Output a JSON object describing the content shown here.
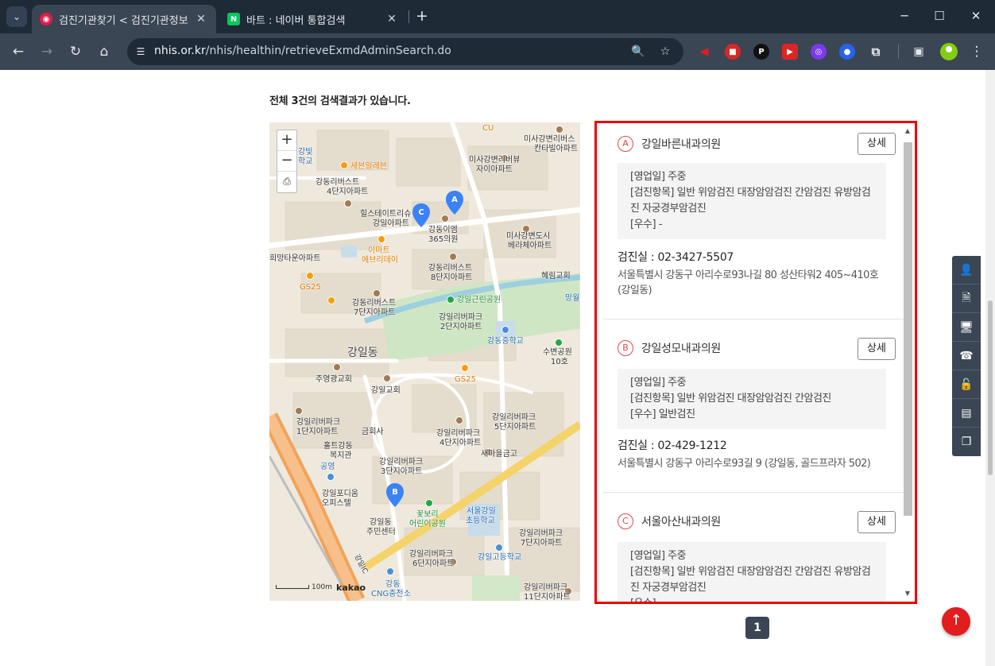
{
  "browser": {
    "tabs": [
      {
        "title": "검진기관찾기 < 검진기관정보",
        "active": true,
        "favicon": "nhis-favicon"
      },
      {
        "title": "바트 : 네이버 통합검색",
        "active": false,
        "favicon": "naver-favicon"
      }
    ],
    "favicon_naver_letter": "N",
    "new_tab_symbol": "+",
    "url_host": "nhis.or.kr",
    "url_path": "/nhis/healthin/retrieveExmdAdminSearch.do",
    "window_controls": {
      "minimize": "─",
      "maximize": "☐",
      "close": "✕"
    }
  },
  "page": {
    "result_count_text": "전체 3건의 검색결과가 있습니다.",
    "pagination": {
      "current": "1"
    }
  },
  "map": {
    "controls": {
      "zoom_in": "+",
      "zoom_out": "−"
    },
    "scale_label": "100m",
    "provider": "kakao",
    "district_label": "강일동",
    "markers": [
      "A",
      "B",
      "C"
    ],
    "labels": [
      "CU",
      "미사강변리버스",
      "칸타빌아파트",
      "강빛",
      "학교",
      "세븐일레븐",
      "미사강변리버뷰",
      "자이아파트",
      "강동리버스트",
      "4단지아파트",
      "힐스테이트리슈",
      "강일아파트",
      "강동이엠",
      "365의원",
      "미사강변도시",
      "베라체아파트",
      "이마트",
      "에브리데이",
      "희망타운아파트",
      "GS25",
      "강동리버스트",
      "8단지아파트",
      "혜림교회",
      "강일근린공원",
      "강동리버스트",
      "7단지아파트",
      "강일리버파크",
      "2단지아파트",
      "강동중학교",
      "수변공원",
      "10호",
      "주영광교회",
      "강일교회",
      "강일리버파크",
      "1단지아파트",
      "금회사",
      "강일리버파크",
      "4단지아파트",
      "강일리버파크",
      "5단지아파트",
      "홀트강동",
      "복지관",
      "공영",
      "강일리버파크",
      "3단지아파트",
      "새마을금고",
      "강일포디움",
      "오피스텔",
      "강일동",
      "주민센터",
      "꽃보리",
      "어린이공원",
      "서울강일",
      "초등학교",
      "강일리버파크",
      "7단지아파트",
      "강일리버파크",
      "6단지아파트",
      "강일고등학교",
      "강동",
      "CNG충전소",
      "강일리버파크",
      "11단지아파트",
      "망월",
      "강일IC"
    ]
  },
  "results": [
    {
      "letter": "A",
      "name": "강일바른내과의원",
      "detail_label": "상세",
      "info_lines": [
        "[영업일] 주중",
        "[검진항목] 일반 위암검진 대장암암검진 간암검진 유방암검진 자궁경부암검진",
        "[우수] -"
      ],
      "phone": "검진실 : 02-3427-5507",
      "address": "서울특별시 강동구 아리수로93나길 80 성산타워2 405~410호 (강일동)"
    },
    {
      "letter": "B",
      "name": "강일성모내과의원",
      "detail_label": "상세",
      "info_lines": [
        "[영업일] 주중",
        "[검진항목] 일반 위암검진 대장암암검진 간암검진",
        "[우수] 일반검진"
      ],
      "phone": "검진실 : 02-429-1212",
      "address": "서울특별시 강동구 아리수로93길 9 (강일동, 골드프라자 502)"
    },
    {
      "letter": "C",
      "name": "서울아산내과의원",
      "detail_label": "상세",
      "info_lines": [
        "[영업일] 주중",
        "[검진항목] 일반 위암검진 대장암암검진 간암검진 유방암검진 자궁경부암검진",
        "[우수] -"
      ],
      "phone": "",
      "address": ""
    }
  ],
  "quick_menu": [
    "user-icon",
    "document-icon",
    "monitor-icon",
    "phone-icon",
    "lock-icon",
    "form-icon",
    "copy-icon"
  ],
  "top_button_symbol": "↑",
  "colors": {
    "highlight_border": "#ee0000",
    "accent_red": "#e5484d",
    "marker_blue": "#3b82f6",
    "dark_chrome": "#3a4654"
  }
}
